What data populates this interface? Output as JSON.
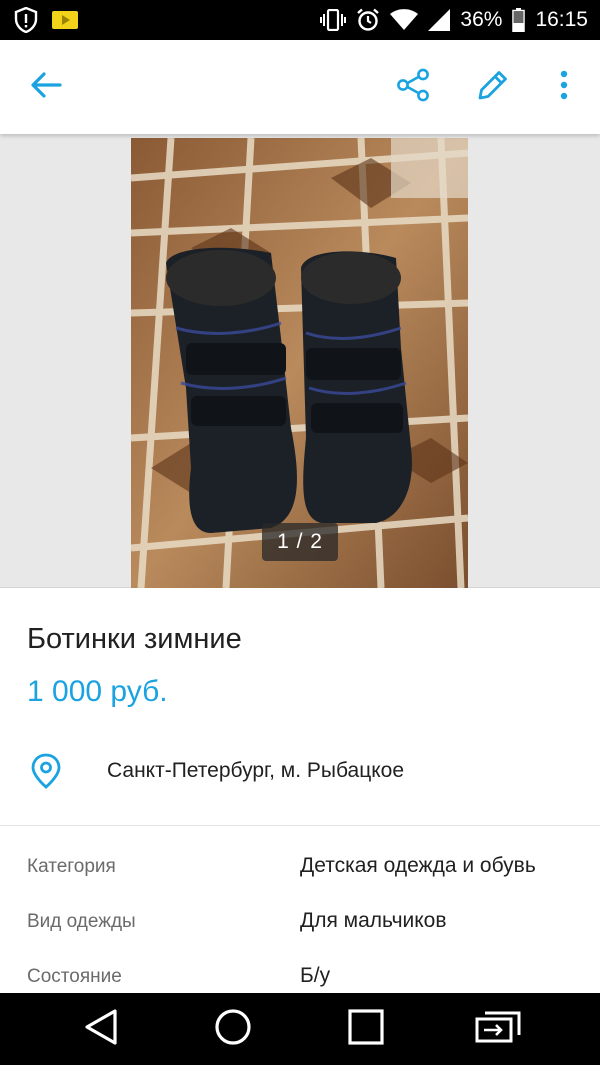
{
  "status_bar": {
    "battery": "36%",
    "time": "16:15",
    "icons": [
      "alert-shield-icon",
      "video-notification-icon",
      "vibrate-icon",
      "alarm-icon",
      "wifi-icon",
      "signal-icon",
      "battery-icon"
    ]
  },
  "toolbar": {
    "icons": [
      "back-arrow-icon",
      "share-icon",
      "edit-pencil-icon",
      "more-vertical-icon"
    ],
    "accent_color": "#1aa3e0"
  },
  "gallery": {
    "counter": "1 / 2",
    "photo_alt": "photo"
  },
  "listing": {
    "title": "Ботинки зимние",
    "price": "1 000 руб.",
    "location": "Санкт-Петербург, м. Рыбацкое",
    "price_color": "#1aa3e0"
  },
  "params": [
    {
      "label": "Категория",
      "value": "Детская одежда и обувь"
    },
    {
      "label": "Вид одежды",
      "value": "Для мальчиков"
    },
    {
      "label": "Состояние",
      "value": "Б/у"
    }
  ],
  "nav_bar": {
    "icons": [
      "nav-back-icon",
      "nav-home-icon",
      "nav-recent-icon",
      "nav-switch-icon"
    ]
  }
}
